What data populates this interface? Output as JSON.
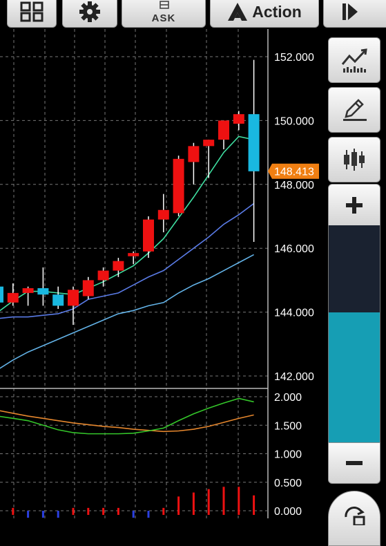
{
  "toolbar": {
    "ask_label": "ASK",
    "action_label": "Action"
  },
  "price_axis": {
    "labels": [
      "152.000",
      "150.000",
      "148.000",
      "146.000",
      "144.000",
      "142.000"
    ],
    "current_price": "148.413"
  },
  "osc_axis": {
    "labels": [
      "2.000",
      "1.500",
      "1.000",
      "0.500",
      "0.000"
    ]
  },
  "colors": {
    "bull": "#ee1111",
    "bear": "#19b8e0",
    "ma_fast": "#3fe0a2",
    "ma_mid": "#5a7be6",
    "ma_slow": "#63b3e8",
    "osc_line1": "#34c72a",
    "osc_line2": "#e6872d",
    "current_price_tag": "#f07f12",
    "zoom_fill": "#169eb4"
  },
  "sidebar": {
    "chart_icon": "line-chart-icon",
    "draw_icon": "pencil-icon",
    "indicator_icon": "candlestick-icon",
    "zoom_in": "plus-icon",
    "zoom_out": "minus-icon",
    "zoom_level": 0.6
  },
  "chart_data": {
    "type": "candlestick",
    "y_range": [
      142.0,
      152.0
    ],
    "candles": [
      {
        "o": 144.8,
        "h": 144.9,
        "l": 144.2,
        "c": 144.3
      },
      {
        "o": 144.3,
        "h": 144.9,
        "l": 144.2,
        "c": 144.6
      },
      {
        "o": 144.6,
        "h": 144.8,
        "l": 144.2,
        "c": 144.75
      },
      {
        "o": 144.75,
        "h": 145.4,
        "l": 144.2,
        "c": 144.55
      },
      {
        "o": 144.55,
        "h": 144.8,
        "l": 144.1,
        "c": 144.2
      },
      {
        "o": 144.2,
        "h": 144.8,
        "l": 143.6,
        "c": 144.7
      },
      {
        "o": 144.5,
        "h": 145.1,
        "l": 144.4,
        "c": 145.0
      },
      {
        "o": 145.0,
        "h": 145.4,
        "l": 144.8,
        "c": 145.3
      },
      {
        "o": 145.3,
        "h": 145.7,
        "l": 145.1,
        "c": 145.6
      },
      {
        "o": 145.75,
        "h": 145.9,
        "l": 145.5,
        "c": 145.85
      },
      {
        "o": 145.9,
        "h": 147.0,
        "l": 145.7,
        "c": 146.9
      },
      {
        "o": 146.9,
        "h": 147.7,
        "l": 146.5,
        "c": 147.2
      },
      {
        "o": 147.1,
        "h": 148.9,
        "l": 147.0,
        "c": 148.8
      },
      {
        "o": 148.7,
        "h": 149.3,
        "l": 148.0,
        "c": 149.2
      },
      {
        "o": 149.2,
        "h": 149.4,
        "l": 148.2,
        "c": 149.4
      },
      {
        "o": 149.4,
        "h": 150.0,
        "l": 149.1,
        "c": 150.0
      },
      {
        "o": 149.9,
        "h": 150.3,
        "l": 149.7,
        "c": 150.2
      },
      {
        "o": 150.2,
        "h": 151.9,
        "l": 146.2,
        "c": 148.41
      }
    ],
    "ma_fast": [
      144.0,
      144.35,
      144.65,
      144.65,
      144.6,
      144.55,
      144.75,
      144.95,
      145.2,
      145.45,
      145.85,
      146.3,
      146.95,
      147.6,
      148.3,
      149.0,
      149.5,
      149.4
    ],
    "ma_mid": [
      143.8,
      143.85,
      143.85,
      143.9,
      143.95,
      144.1,
      144.4,
      144.5,
      144.6,
      144.85,
      145.1,
      145.3,
      145.65,
      146.0,
      146.35,
      146.75,
      147.05,
      147.4
    ],
    "ma_slow": [
      142.2,
      142.5,
      142.75,
      142.95,
      143.15,
      143.35,
      143.55,
      143.75,
      143.95,
      144.05,
      144.2,
      144.3,
      144.6,
      144.85,
      145.05,
      145.3,
      145.55,
      145.8
    ],
    "osc_range": [
      0,
      2.0
    ],
    "osc_line1": [
      1.66,
      1.62,
      1.58,
      1.5,
      1.42,
      1.37,
      1.35,
      1.35,
      1.35,
      1.36,
      1.4,
      1.45,
      1.58,
      1.7,
      1.8,
      1.89,
      1.97,
      1.91
    ],
    "osc_line2": [
      1.76,
      1.71,
      1.66,
      1.62,
      1.58,
      1.54,
      1.51,
      1.48,
      1.46,
      1.43,
      1.41,
      1.39,
      1.4,
      1.43,
      1.48,
      1.55,
      1.62,
      1.68
    ],
    "osc_bars": [
      0.05,
      0.05,
      -0.05,
      -0.05,
      -0.05,
      0.05,
      0.05,
      0.05,
      0.05,
      -0.05,
      -0.05,
      0.05,
      0.25,
      0.32,
      0.38,
      0.42,
      0.42,
      0.27
    ]
  }
}
